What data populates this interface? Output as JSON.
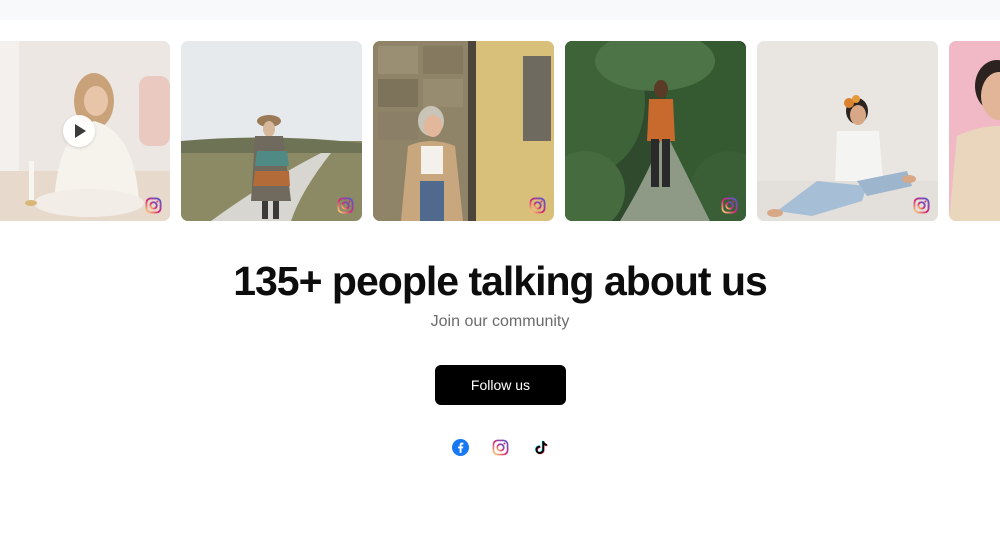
{
  "gallery": {
    "tiles": [
      {
        "name": "gallery-tile-1",
        "type": "video",
        "platform_icon": "instagram-icon"
      },
      {
        "name": "gallery-tile-2",
        "type": "image",
        "platform_icon": "instagram-icon"
      },
      {
        "name": "gallery-tile-3",
        "type": "image",
        "platform_icon": "instagram-icon"
      },
      {
        "name": "gallery-tile-4",
        "type": "image",
        "platform_icon": "instagram-icon"
      },
      {
        "name": "gallery-tile-5",
        "type": "image",
        "platform_icon": "instagram-icon"
      },
      {
        "name": "gallery-tile-6",
        "type": "image",
        "platform_icon": "instagram-icon"
      }
    ]
  },
  "community": {
    "headline": "135+ people talking about us",
    "subline": "Join our community",
    "follow_label": "Follow us"
  },
  "socials": [
    {
      "name": "facebook-icon",
      "color": "#1877f2"
    },
    {
      "name": "instagram-icon",
      "color": "#e1306c"
    },
    {
      "name": "tiktok-icon",
      "color": "#000000"
    }
  ],
  "colors": {
    "button_bg": "#000000",
    "button_text": "#ffffff",
    "headline": "#0d0d0d",
    "subline": "#6b6b6b"
  }
}
